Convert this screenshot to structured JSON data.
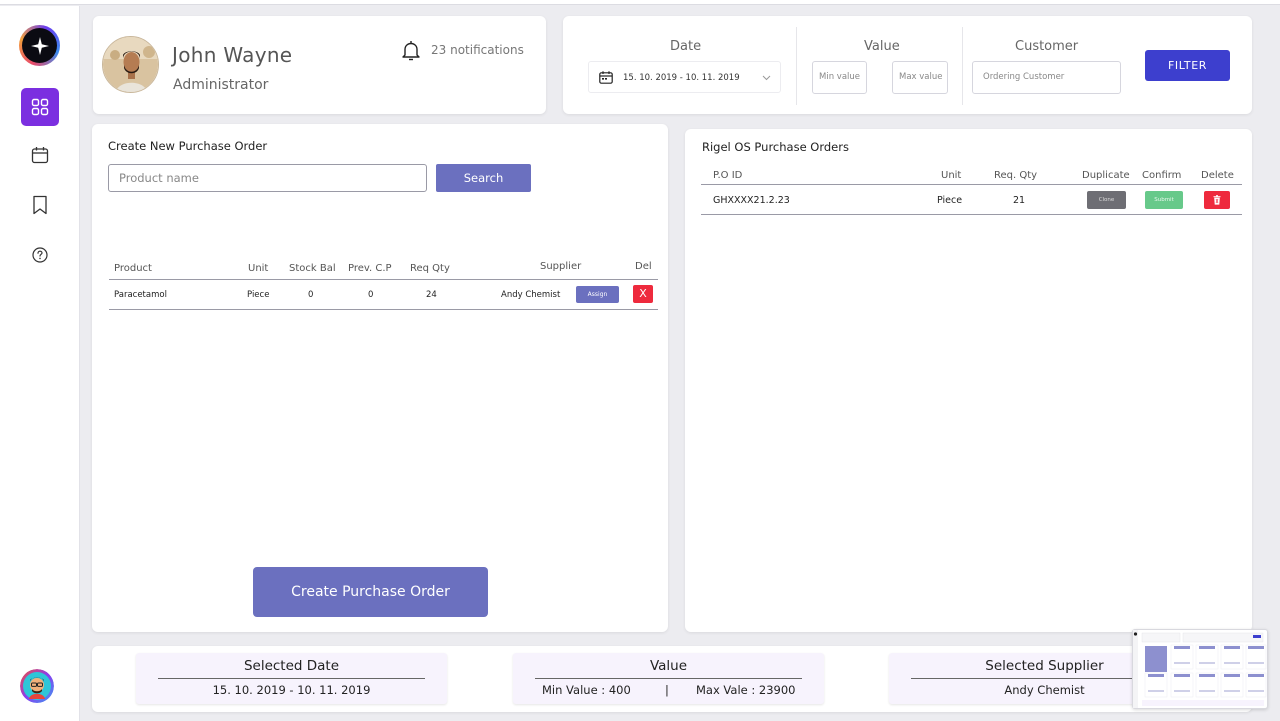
{
  "profile": {
    "name": "John Wayne",
    "role": "Administrator",
    "notifications": "23 notifications"
  },
  "filters": {
    "date_label": "Date",
    "date_range": "15. 10. 2019  -  10. 11. 2019",
    "value_label": "Value",
    "min_placeholder": "Min value",
    "max_placeholder": "Max value",
    "customer_label": "Customer",
    "customer_placeholder": "Ordering Customer",
    "filter_button": "FILTER"
  },
  "create_order": {
    "title": "Create New Purchase Order",
    "search_placeholder": "Product name",
    "search_button": "Search",
    "columns": [
      "Product",
      "Unit",
      "Stock Bal",
      "Prev. C.P",
      "Req Qty",
      "Supplier",
      "Del"
    ],
    "rows": [
      {
        "product": "Paracetamol",
        "unit": "Piece",
        "stock_bal": "0",
        "prev_cp": "0",
        "req_qty": "24",
        "supplier": "Andy Chemist",
        "assign_label": "Assign",
        "del_label": "X"
      }
    ],
    "create_button": "Create Purchase Order"
  },
  "orders": {
    "title": "Rigel OS Purchase Orders",
    "columns": [
      "P.O ID",
      "Unit",
      "Req. Qty",
      "Duplicate",
      "Confirm",
      "Delete"
    ],
    "rows": [
      {
        "po_id": "GHXXXX21.2.23",
        "unit": "Piece",
        "req_qty": "21",
        "clone_label": "Clone",
        "submit_label": "Submit"
      }
    ]
  },
  "summary": {
    "date_title": "Selected Date",
    "date_value": "15. 10. 2019  -  10. 11. 2019",
    "value_title": "Value",
    "min_value": "Min Value : 400",
    "separator": "|",
    "max_value": "Max Vale : 23900",
    "supplier_title": "Selected Supplier",
    "supplier_value": "Andy Chemist"
  },
  "colors": {
    "accent": "#7b2fe0",
    "primary_button": "#6b70bf",
    "filter_button": "#3d3fce",
    "danger": "#ee2a3d",
    "confirm": "#67c98a",
    "clone": "#6e6e74"
  },
  "icons": {
    "sidebar": [
      "dashboard-icon",
      "calendar-icon",
      "bookmark-icon",
      "help-icon"
    ],
    "notification": "bell-icon",
    "date": "calendar-icon",
    "delete": "trash-icon"
  }
}
